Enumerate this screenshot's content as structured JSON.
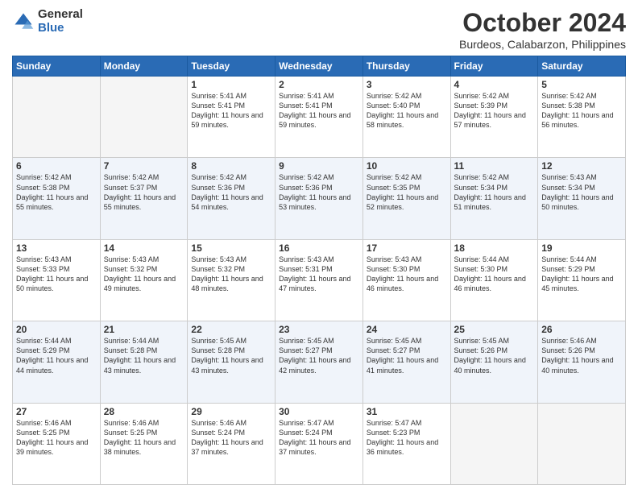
{
  "logo": {
    "general": "General",
    "blue": "Blue"
  },
  "title": {
    "month": "October 2024",
    "location": "Burdeos, Calabarzon, Philippines"
  },
  "days_header": [
    "Sunday",
    "Monday",
    "Tuesday",
    "Wednesday",
    "Thursday",
    "Friday",
    "Saturday"
  ],
  "weeks": [
    [
      {
        "day": "",
        "sunrise": "",
        "sunset": "",
        "daylight": ""
      },
      {
        "day": "",
        "sunrise": "",
        "sunset": "",
        "daylight": ""
      },
      {
        "day": "1",
        "sunrise": "Sunrise: 5:41 AM",
        "sunset": "Sunset: 5:41 PM",
        "daylight": "Daylight: 11 hours and 59 minutes."
      },
      {
        "day": "2",
        "sunrise": "Sunrise: 5:41 AM",
        "sunset": "Sunset: 5:41 PM",
        "daylight": "Daylight: 11 hours and 59 minutes."
      },
      {
        "day": "3",
        "sunrise": "Sunrise: 5:42 AM",
        "sunset": "Sunset: 5:40 PM",
        "daylight": "Daylight: 11 hours and 58 minutes."
      },
      {
        "day": "4",
        "sunrise": "Sunrise: 5:42 AM",
        "sunset": "Sunset: 5:39 PM",
        "daylight": "Daylight: 11 hours and 57 minutes."
      },
      {
        "day": "5",
        "sunrise": "Sunrise: 5:42 AM",
        "sunset": "Sunset: 5:38 PM",
        "daylight": "Daylight: 11 hours and 56 minutes."
      }
    ],
    [
      {
        "day": "6",
        "sunrise": "Sunrise: 5:42 AM",
        "sunset": "Sunset: 5:38 PM",
        "daylight": "Daylight: 11 hours and 55 minutes."
      },
      {
        "day": "7",
        "sunrise": "Sunrise: 5:42 AM",
        "sunset": "Sunset: 5:37 PM",
        "daylight": "Daylight: 11 hours and 55 minutes."
      },
      {
        "day": "8",
        "sunrise": "Sunrise: 5:42 AM",
        "sunset": "Sunset: 5:36 PM",
        "daylight": "Daylight: 11 hours and 54 minutes."
      },
      {
        "day": "9",
        "sunrise": "Sunrise: 5:42 AM",
        "sunset": "Sunset: 5:36 PM",
        "daylight": "Daylight: 11 hours and 53 minutes."
      },
      {
        "day": "10",
        "sunrise": "Sunrise: 5:42 AM",
        "sunset": "Sunset: 5:35 PM",
        "daylight": "Daylight: 11 hours and 52 minutes."
      },
      {
        "day": "11",
        "sunrise": "Sunrise: 5:42 AM",
        "sunset": "Sunset: 5:34 PM",
        "daylight": "Daylight: 11 hours and 51 minutes."
      },
      {
        "day": "12",
        "sunrise": "Sunrise: 5:43 AM",
        "sunset": "Sunset: 5:34 PM",
        "daylight": "Daylight: 11 hours and 50 minutes."
      }
    ],
    [
      {
        "day": "13",
        "sunrise": "Sunrise: 5:43 AM",
        "sunset": "Sunset: 5:33 PM",
        "daylight": "Daylight: 11 hours and 50 minutes."
      },
      {
        "day": "14",
        "sunrise": "Sunrise: 5:43 AM",
        "sunset": "Sunset: 5:32 PM",
        "daylight": "Daylight: 11 hours and 49 minutes."
      },
      {
        "day": "15",
        "sunrise": "Sunrise: 5:43 AM",
        "sunset": "Sunset: 5:32 PM",
        "daylight": "Daylight: 11 hours and 48 minutes."
      },
      {
        "day": "16",
        "sunrise": "Sunrise: 5:43 AM",
        "sunset": "Sunset: 5:31 PM",
        "daylight": "Daylight: 11 hours and 47 minutes."
      },
      {
        "day": "17",
        "sunrise": "Sunrise: 5:43 AM",
        "sunset": "Sunset: 5:30 PM",
        "daylight": "Daylight: 11 hours and 46 minutes."
      },
      {
        "day": "18",
        "sunrise": "Sunrise: 5:44 AM",
        "sunset": "Sunset: 5:30 PM",
        "daylight": "Daylight: 11 hours and 46 minutes."
      },
      {
        "day": "19",
        "sunrise": "Sunrise: 5:44 AM",
        "sunset": "Sunset: 5:29 PM",
        "daylight": "Daylight: 11 hours and 45 minutes."
      }
    ],
    [
      {
        "day": "20",
        "sunrise": "Sunrise: 5:44 AM",
        "sunset": "Sunset: 5:29 PM",
        "daylight": "Daylight: 11 hours and 44 minutes."
      },
      {
        "day": "21",
        "sunrise": "Sunrise: 5:44 AM",
        "sunset": "Sunset: 5:28 PM",
        "daylight": "Daylight: 11 hours and 43 minutes."
      },
      {
        "day": "22",
        "sunrise": "Sunrise: 5:45 AM",
        "sunset": "Sunset: 5:28 PM",
        "daylight": "Daylight: 11 hours and 43 minutes."
      },
      {
        "day": "23",
        "sunrise": "Sunrise: 5:45 AM",
        "sunset": "Sunset: 5:27 PM",
        "daylight": "Daylight: 11 hours and 42 minutes."
      },
      {
        "day": "24",
        "sunrise": "Sunrise: 5:45 AM",
        "sunset": "Sunset: 5:27 PM",
        "daylight": "Daylight: 11 hours and 41 minutes."
      },
      {
        "day": "25",
        "sunrise": "Sunrise: 5:45 AM",
        "sunset": "Sunset: 5:26 PM",
        "daylight": "Daylight: 11 hours and 40 minutes."
      },
      {
        "day": "26",
        "sunrise": "Sunrise: 5:46 AM",
        "sunset": "Sunset: 5:26 PM",
        "daylight": "Daylight: 11 hours and 40 minutes."
      }
    ],
    [
      {
        "day": "27",
        "sunrise": "Sunrise: 5:46 AM",
        "sunset": "Sunset: 5:25 PM",
        "daylight": "Daylight: 11 hours and 39 minutes."
      },
      {
        "day": "28",
        "sunrise": "Sunrise: 5:46 AM",
        "sunset": "Sunset: 5:25 PM",
        "daylight": "Daylight: 11 hours and 38 minutes."
      },
      {
        "day": "29",
        "sunrise": "Sunrise: 5:46 AM",
        "sunset": "Sunset: 5:24 PM",
        "daylight": "Daylight: 11 hours and 37 minutes."
      },
      {
        "day": "30",
        "sunrise": "Sunrise: 5:47 AM",
        "sunset": "Sunset: 5:24 PM",
        "daylight": "Daylight: 11 hours and 37 minutes."
      },
      {
        "day": "31",
        "sunrise": "Sunrise: 5:47 AM",
        "sunset": "Sunset: 5:23 PM",
        "daylight": "Daylight: 11 hours and 36 minutes."
      },
      {
        "day": "",
        "sunrise": "",
        "sunset": "",
        "daylight": ""
      },
      {
        "day": "",
        "sunrise": "",
        "sunset": "",
        "daylight": ""
      }
    ]
  ]
}
